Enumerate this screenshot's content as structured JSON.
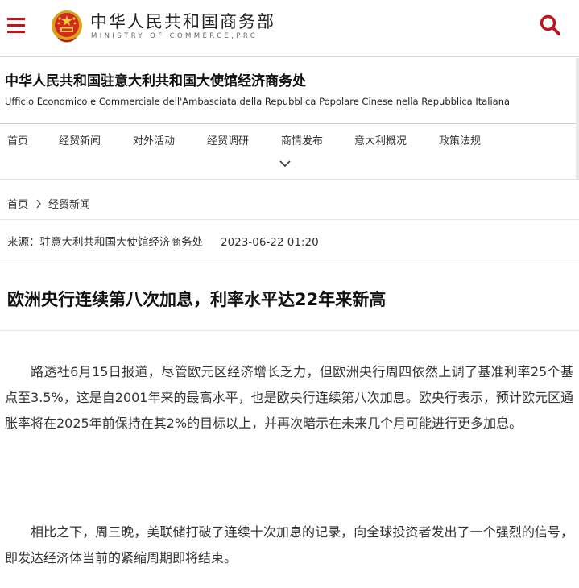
{
  "header": {
    "site_name_cn": "中华人民共和国商务部",
    "site_name_en": "MINISTRY OF COMMERCE,PRC",
    "menu_icon": "hamburger-menu-icon",
    "search_icon": "search-icon",
    "emblem": "national-emblem-logo",
    "accent_color": "#c1131c"
  },
  "department": {
    "title": "中华人民共和国驻意大利共和国大使馆经济商务处",
    "subtitle": "Ufficio Economico e Commerciale dell'Ambasciata della Repubblica Popolare Cinese nella Repubblica Italiana"
  },
  "nav": {
    "items": [
      {
        "label": "首页"
      },
      {
        "label": "经贸新闻"
      },
      {
        "label": "对外活动"
      },
      {
        "label": "经贸调研"
      },
      {
        "label": "商情发布"
      },
      {
        "label": "意大利概况"
      },
      {
        "label": "政策法规"
      }
    ],
    "expand_icon": "chevron-down-icon"
  },
  "breadcrumb": {
    "items": [
      {
        "label": "首页"
      },
      {
        "label": "经贸新闻"
      }
    ],
    "separator_icon": "chevron-right-icon"
  },
  "article": {
    "source": "来源：驻意大利共和国大使馆经济商务处",
    "date": "2023-06-22 01:20",
    "title": "欧洲央行连续第八次加息，利率水平达22年来新高",
    "paragraphs": [
      "路透社6月15日报道，尽管欧元区经济增长乏力，但欧洲央行周四依然上调了基准利率25个基点至3.5%，这是自2001年来的最高水平，也是欧央行连续第八次加息。欧央行表示，预计欧元区通胀率将在2025年前保持在其2%的目标以上，并再次暗示在未来几个月可能进行更多加息。",
      "相比之下，周三晚，美联储打破了连续十次加息的记录，向全球投资者发出了一个强烈的信号，即发达经济体当前的紧缩周期即将结束。"
    ]
  }
}
